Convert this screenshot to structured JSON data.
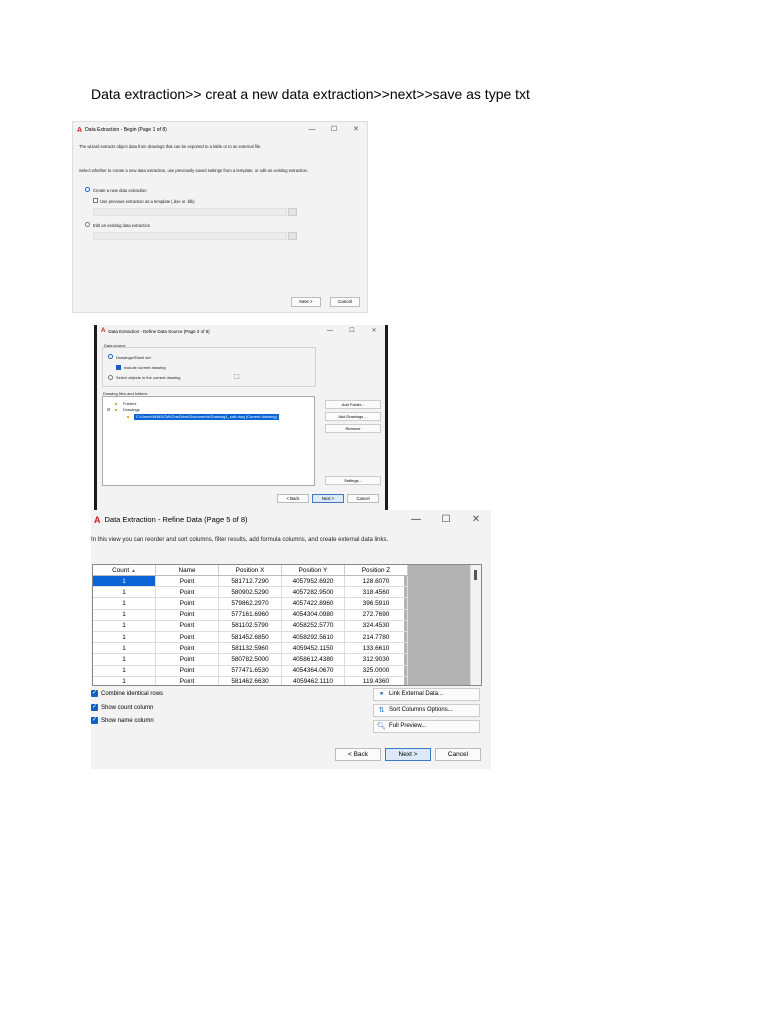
{
  "heading": "Data extraction>> creat a new data extraction>>next>>save as type txt",
  "dialog1": {
    "title": "Data Extraction - Begin (Page 1 of 8)",
    "intro": "The wizard extracts object data from drawings that can be exported to a table or to an external file.",
    "prompt": "Select whether to create a new data extraction, use previously saved settings from a template, or edit an existing extraction.",
    "option_create": "Create a new data extraction",
    "option_template": "Use previous extraction as a template (.dxe or .blk)",
    "option_edit": "Edit an existing data extraction",
    "next_label": "Next >",
    "cancel_label": "Cancel"
  },
  "dialog2": {
    "title": "Data Extraction - Define Data Source (Page 2 of 8)",
    "data_source_label": "Data source",
    "option_drawings": "Drawings/Sheet set",
    "include_current": "Include current drawing",
    "option_select": "Select objects in the current drawing",
    "files_label": "Drawing files and folders:",
    "tree_folders": "Folders",
    "tree_drawings": "Drawings",
    "tree_selected": "C:\\Users\\WINDOW\\OneDrive\\Documents\\Drawing1_sub.dwg (Current drawing)",
    "add_folder": "Add Folder...",
    "add_drawings": "Add Drawings ...",
    "remove": "Remove",
    "settings": "Settings...",
    "back_label": "< Back",
    "next_label": "Next >",
    "cancel_label": "Cancel"
  },
  "dialog3": {
    "title": "Data Extraction - Refine Data (Page 5 of 8)",
    "intro": "In this view you can reorder and sort columns, filter results, add formula columns, and create external data links.",
    "columns": [
      "Count",
      "Name",
      "Position X",
      "Position Y",
      "Position Z"
    ],
    "rows": [
      [
        "1",
        "Point",
        "581712.7290",
        "4057952.6920",
        "128.6070"
      ],
      [
        "1",
        "Point",
        "580902.5290",
        "4057282.9500",
        "318.4560"
      ],
      [
        "1",
        "Point",
        "579862.2970",
        "4057422.8960",
        "396.5910"
      ],
      [
        "1",
        "Point",
        "577161.6960",
        "4054304.0980",
        "272.7690"
      ],
      [
        "1",
        "Point",
        "581102.5790",
        "4058252.5770",
        "324.4530"
      ],
      [
        "1",
        "Point",
        "581452.6850",
        "4058292.5610",
        "214.7780"
      ],
      [
        "1",
        "Point",
        "581132.5960",
        "4059452.1150",
        "133.6610"
      ],
      [
        "1",
        "Point",
        "580782.5000",
        "4058612.4380",
        "312.9030"
      ],
      [
        "1",
        "Point",
        "577471.6530",
        "4054364.0670",
        "325.0000"
      ],
      [
        "1",
        "Point",
        "581462.6630",
        "4059462.1110",
        "119.4360"
      ]
    ],
    "combine_rows": "Combine identical rows",
    "show_count": "Show count column",
    "show_name": "Show name column",
    "link_external": "Link External Data...",
    "sort_options": "Sort Columns Options...",
    "full_preview": "Full Preview...",
    "back_label": "< Back",
    "next_label": "Next >",
    "cancel_label": "Cancel",
    "win_min": "—",
    "win_max": "☐",
    "win_close": "✕"
  }
}
